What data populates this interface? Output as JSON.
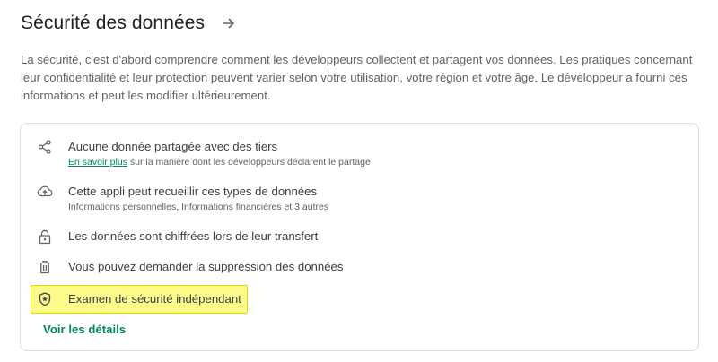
{
  "header": {
    "title": "Sécurité des données"
  },
  "description": "La sécurité, c'est d'abord comprendre comment les développeurs collectent et partagent vos données. Les pratiques concernant leur confidentialité et leur protection peuvent varier selon votre utilisation, votre région et votre âge. Le développeur a fourni ces informations et peut les modifier ultérieurement.",
  "items": [
    {
      "icon": "share-icon",
      "label": "Aucune donnée partagée avec des tiers",
      "link": "En savoir plus",
      "sub": " sur la manière dont les développeurs déclarent le partage"
    },
    {
      "icon": "cloud-upload-icon",
      "label": "Cette appli peut recueillir ces types de données",
      "sub": "Informations personnelles, Informations financières et 3 autres"
    },
    {
      "icon": "lock-icon",
      "label": "Les données sont chiffrées lors de leur transfert"
    },
    {
      "icon": "trash-icon",
      "label": "Vous pouvez demander la suppression des données"
    },
    {
      "icon": "shield-icon",
      "label": "Examen de sécurité indépendant"
    }
  ],
  "details_link": "Voir les détails",
  "colors": {
    "accent": "#01875f",
    "highlight": "#fdfb8a",
    "border": "#dadce0"
  }
}
